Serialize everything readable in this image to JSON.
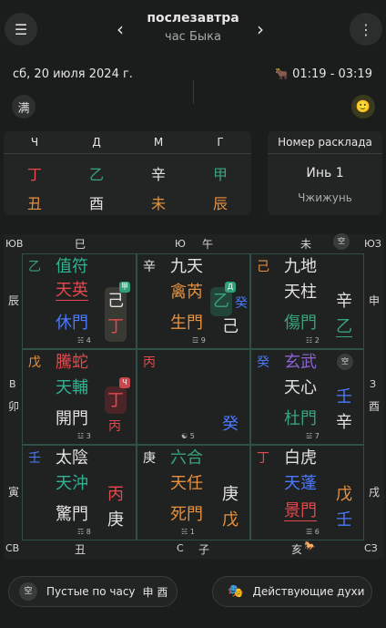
{
  "header": {
    "title": "послезавтра",
    "subtitle": "час Быка",
    "date": "сб, 20 июля 2024 г.",
    "time_range": "01:19 - 03:19",
    "manchu_char": "满"
  },
  "pillars": {
    "headers": [
      "Ч",
      "Д",
      "М",
      "Г"
    ],
    "stems": [
      "丁",
      "乙",
      "辛",
      "甲"
    ],
    "branches": [
      "丑",
      "酉",
      "未",
      "辰"
    ]
  },
  "layout_card": {
    "title": "Номер расклада",
    "value": "Инь 1",
    "sub": "Чжижунь"
  },
  "board": {
    "edge": {
      "se": "ЮВ",
      "s": "Ю",
      "sw": "ЮЗ",
      "e": "В",
      "w": "З",
      "ne": "СВ",
      "n": "С",
      "nw": "СЗ",
      "top_si": "巳",
      "top_wu": "午",
      "top_wei": "未",
      "left_chen": "辰",
      "left_mao": "卯",
      "left_yin": "寅",
      "right_shen": "申",
      "right_you": "酉",
      "right_xu": "戌",
      "bot_chou": "丑",
      "bot_zi": "子",
      "bot_hai": "亥"
    },
    "cells": [
      {
        "stem": "乙",
        "god": "值符",
        "star": "天英",
        "door": "休門",
        "num": "4",
        "k1": "己",
        "k2": "丁",
        "badge": "甲"
      },
      {
        "stem": "辛",
        "god": "九天",
        "star": "禽芮",
        "door": "生門",
        "num": "9",
        "k1": "乙",
        "k2": "己",
        "badge": "Д",
        "extra": "癸"
      },
      {
        "stem": "己",
        "god": "九地",
        "star": "天柱",
        "door": "傷門",
        "num": "2",
        "k1": "辛",
        "k2": "乙"
      },
      {
        "stem": "戊",
        "god": "騰蛇",
        "star": "天輔",
        "door": "開門",
        "num": "3",
        "k1": "丁",
        "k2": "丙",
        "badge": "Ч"
      },
      {
        "stem": "丙",
        "num": "5",
        "k1": "癸"
      },
      {
        "stem": "癸",
        "god": "玄武",
        "star": "天心",
        "door": "杜門",
        "num": "7",
        "k1": "壬",
        "k2": "辛"
      },
      {
        "stem": "壬",
        "god": "太陰",
        "star": "天沖",
        "door": "驚門",
        "num": "8",
        "k1": "丙",
        "k2": "庚"
      },
      {
        "stem": "庚",
        "god": "六合",
        "star": "天任",
        "door": "死門",
        "num": "1",
        "k1": "庚",
        "k2": "戊"
      },
      {
        "stem": "丁",
        "god": "白虎",
        "star": "天蓬",
        "door": "景門",
        "num": "6",
        "k1": "戊",
        "k2": "壬"
      }
    ]
  },
  "bottom": {
    "empty_label": "Пустые по часу",
    "empty_chars": "申 酉",
    "spirits_label": "Действующие духи"
  },
  "colors": {
    "bg": "#1b1d1c",
    "accent": "#2f5046",
    "red": "#e5484d",
    "green": "#39a47a",
    "blue": "#4a79ff",
    "orange": "#e7913f"
  }
}
